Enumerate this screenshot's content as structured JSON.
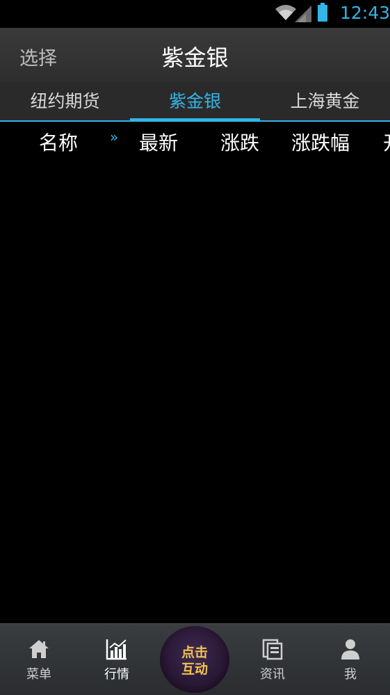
{
  "status_bar": {
    "time": "12:43",
    "battery_color": "#33b5e5"
  },
  "header": {
    "left_button": "选择",
    "title": "紫金银"
  },
  "tabs": [
    {
      "label": "纽约期货",
      "active": false
    },
    {
      "label": "紫金银",
      "active": true
    },
    {
      "label": "上海黄金",
      "active": false
    }
  ],
  "columns": {
    "name": "名称",
    "scroll_indicator": "»",
    "latest": "最新",
    "change": "涨跌",
    "change_pct": "涨跌幅",
    "partial_next": "开"
  },
  "bottom_nav": {
    "items": [
      {
        "label": "菜单",
        "icon": "home-icon"
      },
      {
        "label": "行情",
        "icon": "chart-icon"
      },
      {
        "label": "资讯",
        "icon": "news-icon"
      },
      {
        "label": "我",
        "icon": "person-icon"
      }
    ],
    "center_button": {
      "line1": "点击",
      "line2": "互动"
    }
  },
  "colors": {
    "accent": "#33b5e5",
    "center_text": "#f2c24c"
  }
}
